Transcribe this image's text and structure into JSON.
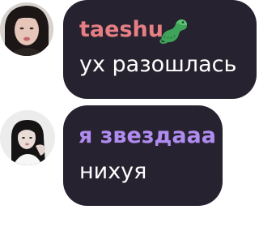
{
  "messages": [
    {
      "username": "taeshu",
      "username_color": "#e57f84",
      "badge_icon": "crocodile-icon",
      "text": "ух разошлась",
      "avatar_icon": "user-avatar-photo"
    },
    {
      "username": "я звездааа",
      "username_color": "#b08cf0",
      "text": "нихуя",
      "avatar_icon": "user-avatar-photo"
    }
  ],
  "bubble_color": "#27222f",
  "text_color": "#ffffff"
}
